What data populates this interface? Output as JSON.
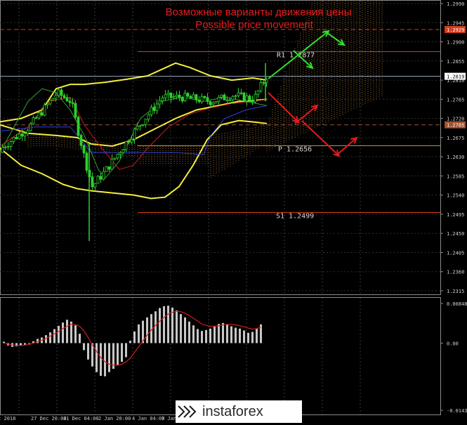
{
  "chart_data": {
    "type": "candlestick",
    "title": "Возможные варианты движения цены",
    "subtitle": "Possible price movement",
    "price_axis": {
      "ylim": [
        1.2285,
        1.2975
      ],
      "ticks": [
        "1.2990",
        "1.2945",
        "1.2900",
        "1.2855",
        "1.2810",
        "1.2765",
        "1.2720",
        "1.2675",
        "1.2630",
        "1.2585",
        "1.2540",
        "1.2495",
        "1.2450",
        "1.2405",
        "1.2360",
        "1.2315"
      ],
      "current_price_label": "1.2819",
      "markers": [
        "1.2929",
        "1.2705"
      ]
    },
    "levels": [
      {
        "name": "R1",
        "label": "R1 1.2877",
        "value": 1.2877,
        "color": "#d63c1c"
      },
      {
        "name": "P",
        "label": "P 1.2656",
        "value": 1.2656,
        "color": "#d29a2a"
      },
      {
        "name": "S1",
        "label": "S1 1.2499",
        "value": 1.2499,
        "color": "#d63c1c"
      }
    ],
    "hlines": [
      {
        "value": 1.2929,
        "color": "#d63c1c",
        "style": "dashed"
      },
      {
        "value": 1.2705,
        "color": "#a0522d",
        "style": "dashed"
      },
      {
        "value": 1.2819,
        "color": "#9aa8c0",
        "style": "solid"
      }
    ],
    "x_labels": [
      "27 Dec 2018",
      "27 Dec 20:00",
      "31 Dec 04:00",
      "2 Jan 20:00",
      "4 Jan 04:00",
      "7 Jan"
    ],
    "macd": {
      "axis_ticks": [
        "0.00848",
        "0.00",
        "-0.01436"
      ],
      "ylim": [
        -0.01436,
        0.00848
      ],
      "histogram": [
        0.0003,
        -0.0005,
        -0.0008,
        -0.0007,
        -0.0006,
        -0.0004,
        -0.0001,
        0.0004,
        0.0009,
        0.0012,
        0.0017,
        0.0023,
        0.003,
        0.0037,
        0.0044,
        0.005,
        0.0046,
        0.0038,
        0.002,
        -0.0015,
        -0.0035,
        -0.005,
        -0.0062,
        -0.007,
        -0.0071,
        -0.0062,
        -0.0055,
        -0.0048,
        -0.004,
        -0.003,
        0.0005,
        0.0025,
        0.004,
        0.0048,
        0.0055,
        0.0062,
        0.0068,
        0.0075,
        0.0079,
        0.008,
        0.0076,
        0.007,
        0.0062,
        0.0055,
        0.0046,
        0.0038,
        0.003,
        0.0026,
        0.0028,
        0.0031,
        0.0037,
        0.0041,
        0.0043,
        0.004,
        0.0036,
        0.0033,
        0.0031,
        0.0027,
        0.0022,
        0.0024,
        0.0031,
        0.004
      ],
      "signal": [
        0.0,
        -0.0002,
        -0.0004,
        -0.0005,
        -0.0005,
        -0.0004,
        -0.0003,
        0.0,
        0.0003,
        0.0006,
        0.001,
        0.0015,
        0.002,
        0.0025,
        0.0031,
        0.0036,
        0.004,
        0.004,
        0.0036,
        0.0026,
        0.0012,
        -0.0004,
        -0.0018,
        -0.0031,
        -0.004,
        -0.0045,
        -0.0047,
        -0.0047,
        -0.0045,
        -0.004,
        -0.0032,
        -0.002,
        -0.0008,
        0.0005,
        0.0017,
        0.0028,
        0.0038,
        0.0047,
        0.0055,
        0.0062,
        0.0066,
        0.0068,
        0.0067,
        0.0064,
        0.0059,
        0.0053,
        0.0047,
        0.0041,
        0.0038,
        0.0036,
        0.0036,
        0.0037,
        0.0039,
        0.004,
        0.004,
        0.0039,
        0.0037,
        0.0035,
        0.0032,
        0.003,
        0.0031,
        0.0034
      ]
    }
  },
  "logo": {
    "text": "instaforex"
  },
  "colors": {
    "bollinger": "#f4ee3c",
    "candles": "#2fd02f",
    "ma_slow": "#2f3fe0",
    "ma_red": "#cc1c1c",
    "ichimoku_cloud": "#c88a3c",
    "arrow_up": "#2fe02f",
    "arrow_down": "#e01c1c",
    "macd_hist": "#c8c8c8",
    "macd_signal": "#d01c1c"
  }
}
